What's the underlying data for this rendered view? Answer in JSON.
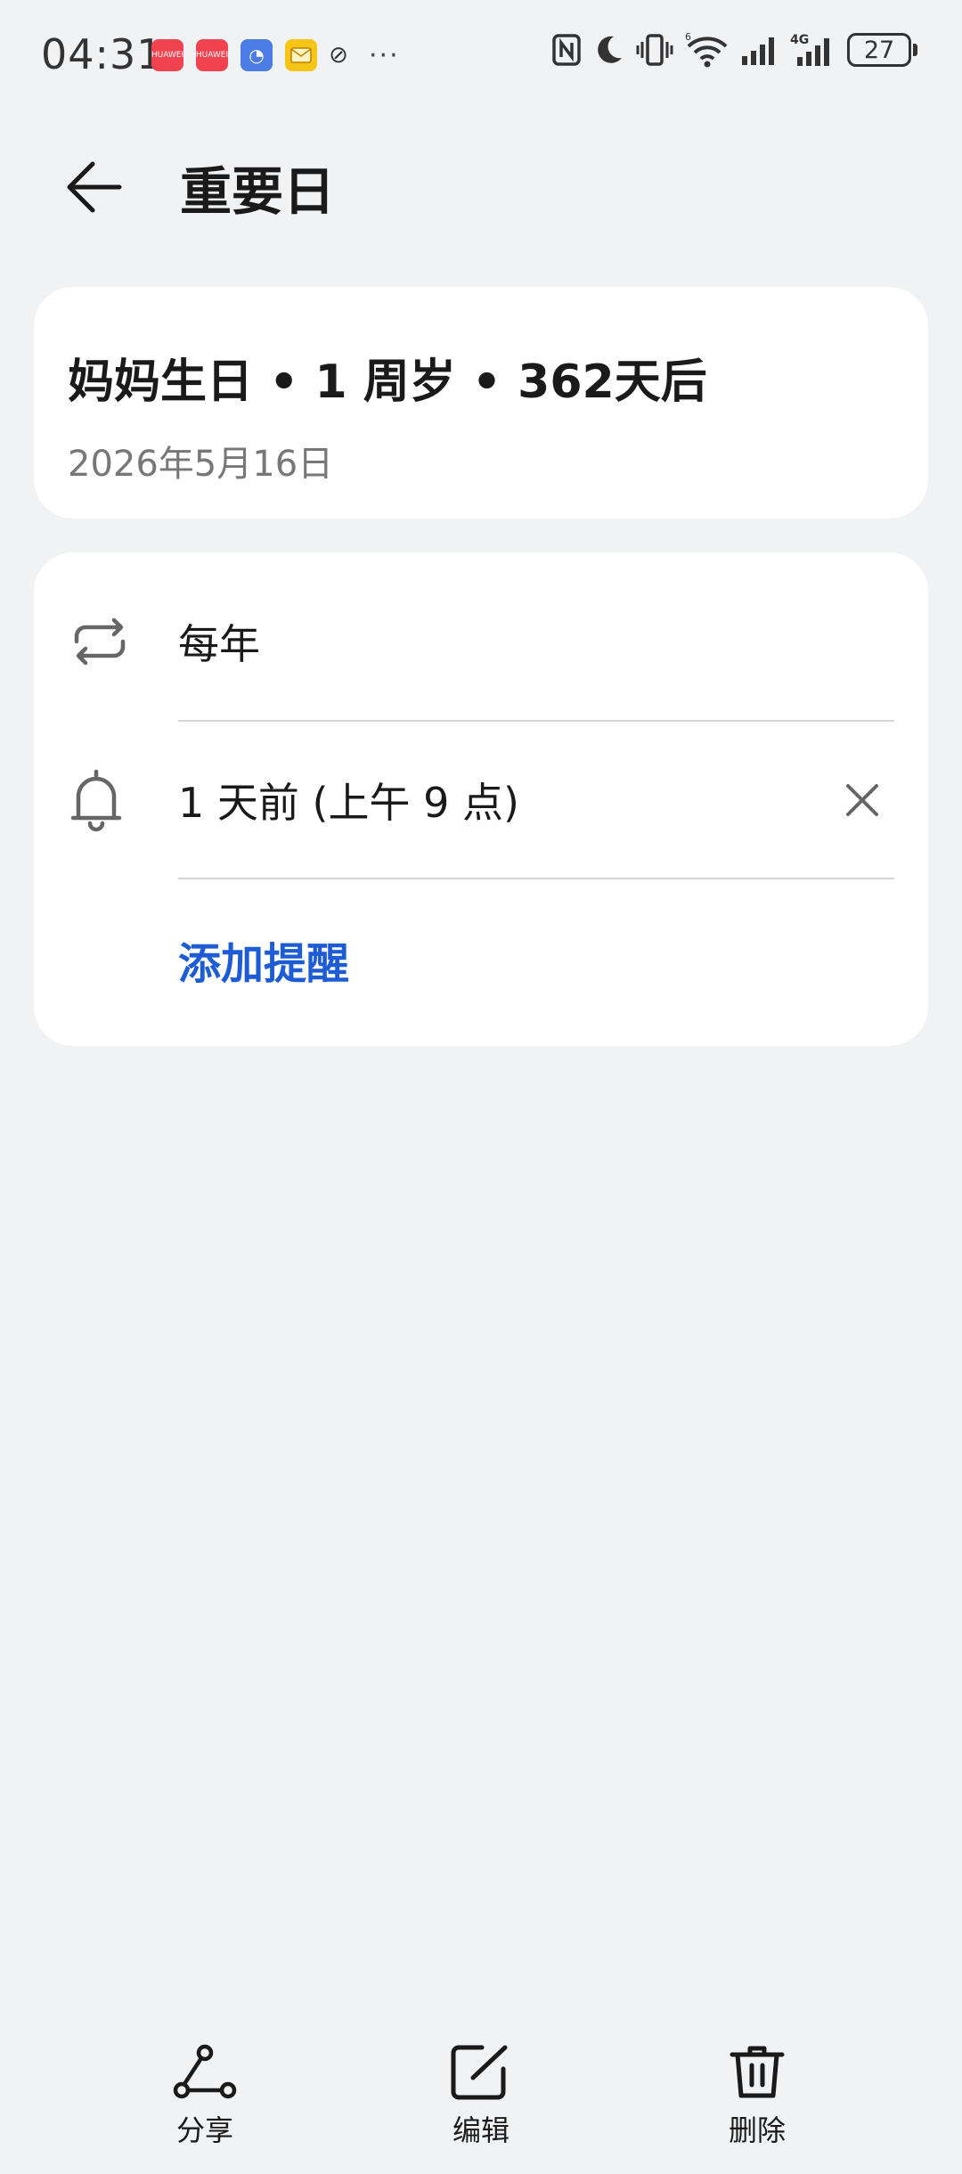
{
  "status_bar": {
    "time": "04:31",
    "notifications": [
      {
        "icon": "huawei-appgallery-icon",
        "label": "HUAWEI"
      },
      {
        "icon": "huawei-appgallery-icon",
        "label": "HUAWEI"
      },
      {
        "icon": "browser-icon",
        "label": ""
      },
      {
        "icon": "email-icon",
        "label": ""
      },
      {
        "icon": "link-icon",
        "label": ""
      }
    ],
    "more": "···",
    "network_label": "4G",
    "wifi_label": "6",
    "battery": "27"
  },
  "header": {
    "back_icon": "arrow-left-icon",
    "title": "重要日"
  },
  "event": {
    "title": "妈妈生日 • 1 周岁 • 362天后",
    "date": "2026年5月16日"
  },
  "details": {
    "repeat": {
      "icon": "repeat-icon",
      "label": "每年"
    },
    "reminder": {
      "icon": "bell-icon",
      "label": "1 天前 (上午 9 点)"
    },
    "add_reminder": "添加提醒"
  },
  "bottom_bar": {
    "share": "分享",
    "edit": "编辑",
    "delete": "删除"
  },
  "colors": {
    "background": "#f1f2f4",
    "card": "#ffffff",
    "accent": "#1e5cd6",
    "text_primary": "#1a1a1a",
    "text_secondary": "#777777"
  }
}
